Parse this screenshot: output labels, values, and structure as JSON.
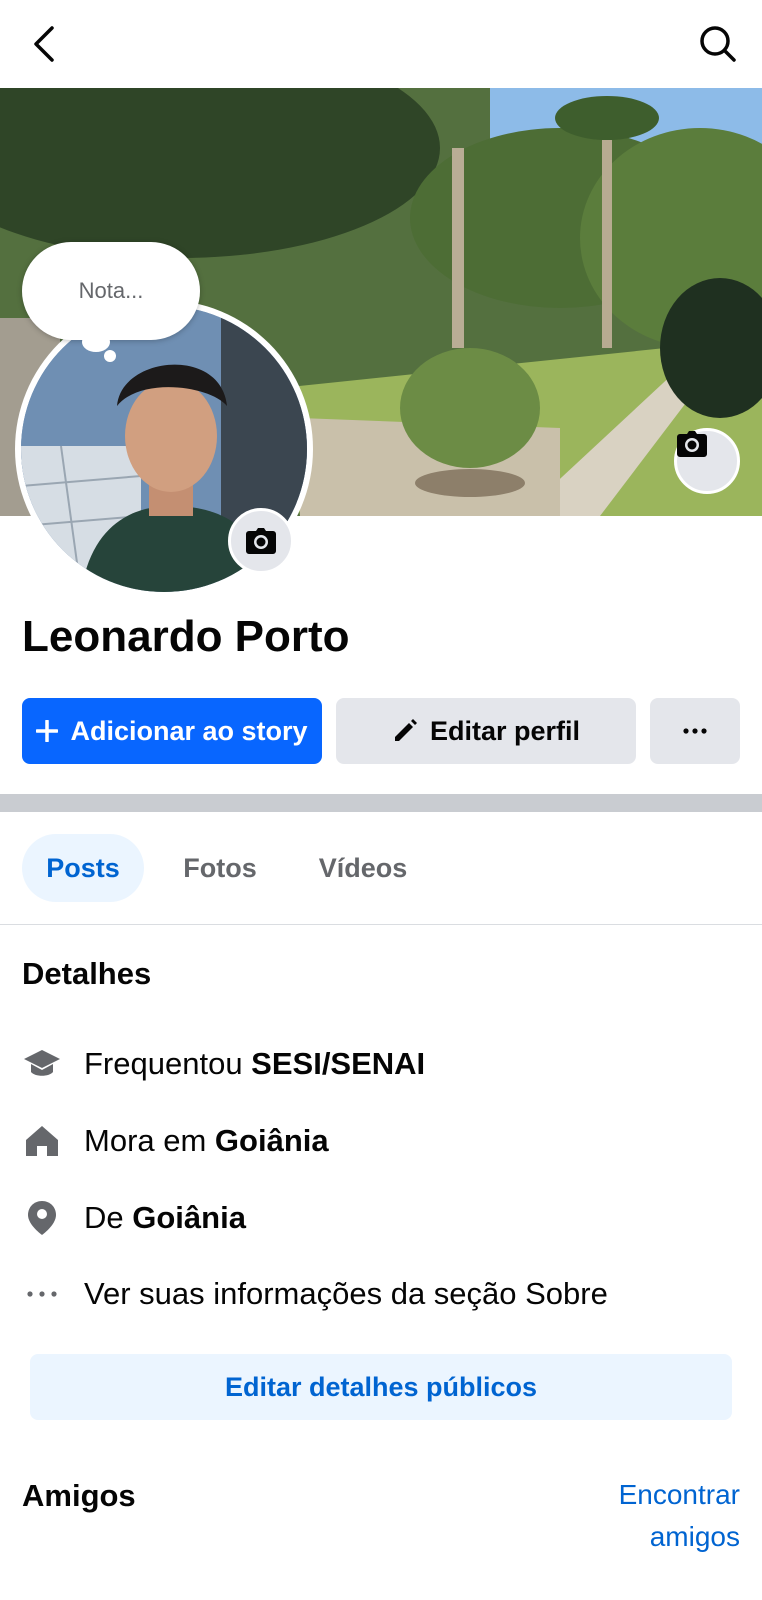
{
  "header": {
    "back_icon": "chevron-left-icon",
    "search_icon": "search-icon"
  },
  "profile": {
    "note_placeholder": "Nota...",
    "name": "Leonardo Porto",
    "cover_camera_icon": "camera-icon",
    "avatar_camera_icon": "camera-icon"
  },
  "actions": {
    "add_story_label": "Adicionar ao story",
    "edit_profile_label": "Editar perfil",
    "more_label": "···"
  },
  "tabs": [
    {
      "label": "Posts",
      "active": true
    },
    {
      "label": "Fotos",
      "active": false
    },
    {
      "label": "Vídeos",
      "active": false
    }
  ],
  "details": {
    "title": "Detalhes",
    "items": [
      {
        "icon": "graduation-cap-icon",
        "prefix": "Frequentou ",
        "value": "SESI/SENAI"
      },
      {
        "icon": "home-icon",
        "prefix": "Mora em ",
        "value": "Goiânia"
      },
      {
        "icon": "location-pin-icon",
        "prefix": "De ",
        "value": "Goiânia"
      },
      {
        "icon": "more-dots-icon",
        "prefix": "Ver suas informações da seção Sobre",
        "value": ""
      }
    ],
    "edit_public_label": "Editar detalhes públicos"
  },
  "friends": {
    "title": "Amigos",
    "find_line1": "Encontrar",
    "find_line2": "amigos"
  },
  "colors": {
    "accent": "#0866ff",
    "link": "#0064d1",
    "secondary_bg": "#e4e6eb",
    "tab_active_bg": "#ebf5ff"
  }
}
